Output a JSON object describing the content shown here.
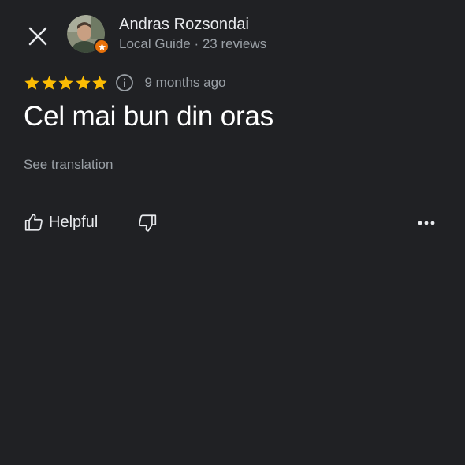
{
  "header": {
    "close_icon": "close-icon",
    "author_name": "Andras Rozsondai",
    "author_meta": "Local Guide · 23 reviews",
    "avatar_icon": "user-avatar",
    "badge_icon": "local-guide-star-icon"
  },
  "review": {
    "rating": 5,
    "rating_max": 5,
    "star_color": "#fbbc04",
    "time": "9 months ago",
    "text": "Cel mai bun din oras",
    "see_translation": "See translation"
  },
  "actions": {
    "helpful_label": "Helpful",
    "helpful_icon": "thumbs-up-icon",
    "dislike_icon": "thumbs-down-icon",
    "more_icon": "more-horizontal-icon"
  },
  "colors": {
    "background": "#202124",
    "primary_text": "#e8eaed",
    "secondary_text": "#9aa0a6",
    "badge": "#e8710a"
  }
}
